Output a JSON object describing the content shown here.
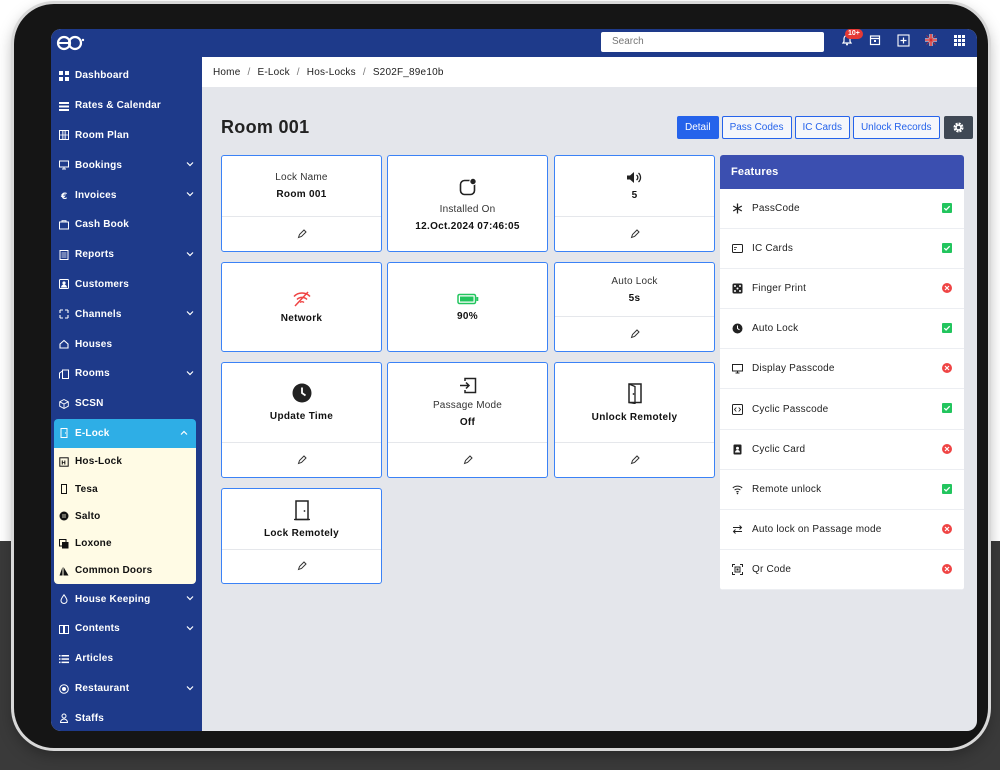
{
  "topbar": {
    "search_placeholder": "Search",
    "notification_count": "10+"
  },
  "sidebar": {
    "items": [
      {
        "label": "Dashboard",
        "icon": "dashboard-icon",
        "has_chevron": false
      },
      {
        "label": "Rates & Calendar",
        "icon": "rates-icon",
        "has_chevron": false
      },
      {
        "label": "Room Plan",
        "icon": "grid-icon",
        "has_chevron": false
      },
      {
        "label": "Bookings",
        "icon": "monitor-icon",
        "has_chevron": true
      },
      {
        "label": "Invoices",
        "icon": "euro-icon",
        "has_chevron": true
      },
      {
        "label": "Cash Book",
        "icon": "cashbook-icon",
        "has_chevron": false
      },
      {
        "label": "Reports",
        "icon": "reports-icon",
        "has_chevron": true
      },
      {
        "label": "Customers",
        "icon": "customers-icon",
        "has_chevron": false
      },
      {
        "label": "Channels",
        "icon": "channels-icon",
        "has_chevron": true
      },
      {
        "label": "Houses",
        "icon": "house-icon",
        "has_chevron": false
      },
      {
        "label": "Rooms",
        "icon": "rooms-icon",
        "has_chevron": true
      },
      {
        "label": "SCSN",
        "icon": "cube-icon",
        "has_chevron": false
      },
      {
        "label": "E-Lock",
        "icon": "door-icon",
        "has_chevron": true,
        "active": true
      }
    ],
    "elock_sub": [
      {
        "label": "Hos-Lock",
        "icon": "hos-lock-icon"
      },
      {
        "label": "Tesa",
        "icon": "tesa-icon"
      },
      {
        "label": "Salto",
        "icon": "salto-icon"
      },
      {
        "label": "Loxone",
        "icon": "loxone-icon"
      },
      {
        "label": "Common Doors",
        "icon": "common-doors-icon"
      }
    ],
    "after": [
      {
        "label": "House Keeping",
        "icon": "drop-icon",
        "has_chevron": true
      },
      {
        "label": "Contents",
        "icon": "book-icon",
        "has_chevron": true
      },
      {
        "label": "Articles",
        "icon": "list-icon",
        "has_chevron": false
      },
      {
        "label": "Restaurant",
        "icon": "restaurant-icon",
        "has_chevron": true
      },
      {
        "label": "Staffs",
        "icon": "user-icon",
        "has_chevron": false
      }
    ]
  },
  "breadcrumb": {
    "items": [
      "Home",
      "E-Lock",
      "Hos-Locks",
      "S202F_89e10b"
    ],
    "sep": "/"
  },
  "page": {
    "title": "Room 001",
    "tabs": [
      "Detail",
      "Pass Codes",
      "IC Cards",
      "Unlock Records"
    ]
  },
  "cards": {
    "lock_name_label": "Lock Name",
    "lock_name_value": "Room 001",
    "installed_label": "Installed On",
    "installed_value": "12.Oct.2024 07:46:05",
    "volume_value": "5",
    "network_label": "Network",
    "battery_value": "90%",
    "auto_lock_label": "Auto Lock",
    "auto_lock_value": "5s",
    "update_time_label": "Update Time",
    "passage_mode_label": "Passage Mode",
    "passage_mode_value": "Off",
    "unlock_remotely_label": "Unlock Remotely",
    "lock_remotely_label": "Lock Remotely"
  },
  "features": {
    "title": "Features",
    "rows": [
      {
        "label": "PassCode",
        "icon": "asterisk-icon",
        "enabled": true
      },
      {
        "label": "IC Cards",
        "icon": "card-icon",
        "enabled": true
      },
      {
        "label": "Finger Print",
        "icon": "dice-icon",
        "enabled": false
      },
      {
        "label": "Auto Lock",
        "icon": "clock-icon",
        "enabled": true
      },
      {
        "label": "Display Passcode",
        "icon": "display-icon",
        "enabled": false
      },
      {
        "label": "Cyclic Passcode",
        "icon": "code-icon",
        "enabled": true
      },
      {
        "label": "Cyclic Card",
        "icon": "badge-icon",
        "enabled": false
      },
      {
        "label": "Remote unlock",
        "icon": "wifi-icon",
        "enabled": true
      },
      {
        "label": "Auto lock on Passage mode",
        "icon": "swap-icon",
        "enabled": false
      },
      {
        "label": "Qr Code",
        "icon": "qr-icon",
        "enabled": false
      }
    ]
  },
  "colors": {
    "sidebar": "#1e3a8a",
    "accent": "#2563eb",
    "active_menu": "#2eaee6",
    "submenu_bg": "#fffbe5",
    "check_green": "#22c55e",
    "cross_red": "#ef4444",
    "network_red": "#ef4444",
    "battery_green": "#22c55e"
  }
}
